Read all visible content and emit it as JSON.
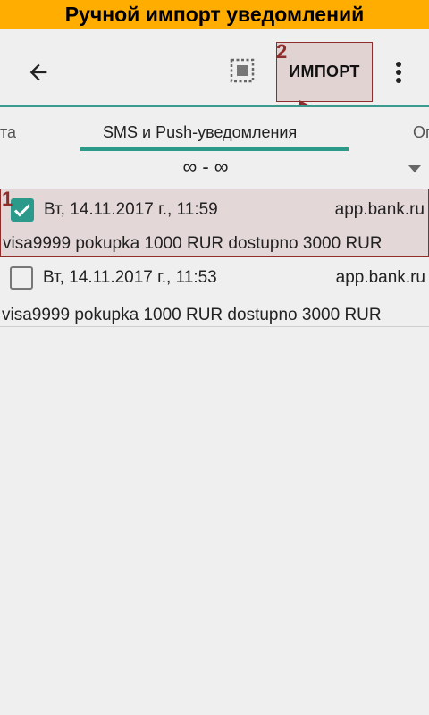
{
  "banner": {
    "title": "Ручной импорт уведомлений"
  },
  "toolbar": {
    "back_icon": "arrow-left-icon",
    "select_icon": "select-all-icon",
    "import_label": "ИМПОРТ",
    "more_icon": "more-vert-icon"
  },
  "annotations": {
    "step1": "1",
    "step2": "2",
    "color": "#8f2c2c"
  },
  "tabs": [
    {
      "label": "та"
    },
    {
      "label": "SMS и Push-уведомления"
    },
    {
      "label": "Ог"
    }
  ],
  "period": {
    "value": "∞ - ∞"
  },
  "items": [
    {
      "checked": true,
      "date": "Вт, 14.11.2017 г., 11:59",
      "source": "app.bank.ru",
      "body": "visa9999 pokupka 1000 RUR dostupno 3000 RUR"
    },
    {
      "checked": false,
      "date": "Вт, 14.11.2017 г., 11:53",
      "source": "app.bank.ru",
      "body": "visa9999 pokupka 1000 RUR dostupno 3000 RUR"
    }
  ],
  "colors": {
    "banner": "#ffad00",
    "accent": "#2b9a8a",
    "background": "#efefef"
  }
}
